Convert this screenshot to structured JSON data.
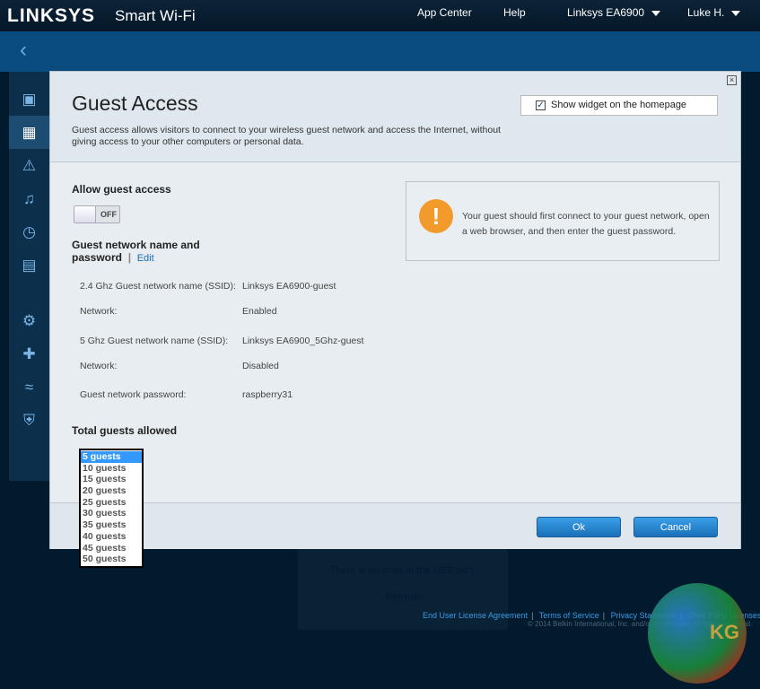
{
  "topbar": {
    "logo": "LINKSYS",
    "product": "Smart Wi-Fi",
    "app_center": "App Center",
    "help": "Help",
    "router": "Linksys EA6900",
    "user": "Luke H."
  },
  "sidebar": {
    "items": [
      "devices-icon",
      "guest-access-icon",
      "parental-controls-icon",
      "media-prioritization-icon",
      "speed-test-icon",
      "external-storage-icon",
      "connectivity-icon",
      "troubleshooting-icon",
      "wireless-icon",
      "security-icon"
    ]
  },
  "modal": {
    "title": "Guest Access",
    "description": "Guest access allows visitors to connect to your wireless guest network and access the Internet, without giving access to your other computers or personal data.",
    "widget_label": "Show widget on the homepage",
    "widget_checked": true,
    "allow_label": "Allow guest access",
    "toggle_state": "OFF",
    "network_heading": "Guest network name and password",
    "edit": "Edit",
    "rows": [
      {
        "label": "2.4 Ghz Guest network name (SSID):",
        "value": "Linksys EA6900-guest"
      },
      {
        "label": "Network:",
        "value": "Enabled"
      },
      {
        "label": "5 Ghz Guest network name (SSID):",
        "value": "Linksys EA6900_5Ghz-guest"
      },
      {
        "label": "Network:",
        "value": "Disabled"
      },
      {
        "label": "Guest network password:",
        "value": "raspberry31"
      }
    ],
    "info": "Your guest should first connect to your guest network, open a web browser, and then enter the guest password.",
    "total_label": "Total guests allowed",
    "guest_options": [
      "5 guests",
      "10 guests",
      "15 guests",
      "20 guests",
      "25 guests",
      "30 guests",
      "35 guests",
      "40 guests",
      "45 guests",
      "50 guests"
    ],
    "selected": "5 guests",
    "ok": "Ok",
    "cancel": "Cancel"
  },
  "background": {
    "usb_text": "There is no drive in the USB port.",
    "refresh": "Refresh"
  },
  "footer": {
    "links": [
      "End User License Agreement",
      "Terms of Service",
      "Privacy Statement",
      "Third Party Licenses"
    ],
    "copyright": "© 2014 Belkin International, Inc. and/or its affiliates. All rights reserved."
  },
  "watermark": "KG"
}
